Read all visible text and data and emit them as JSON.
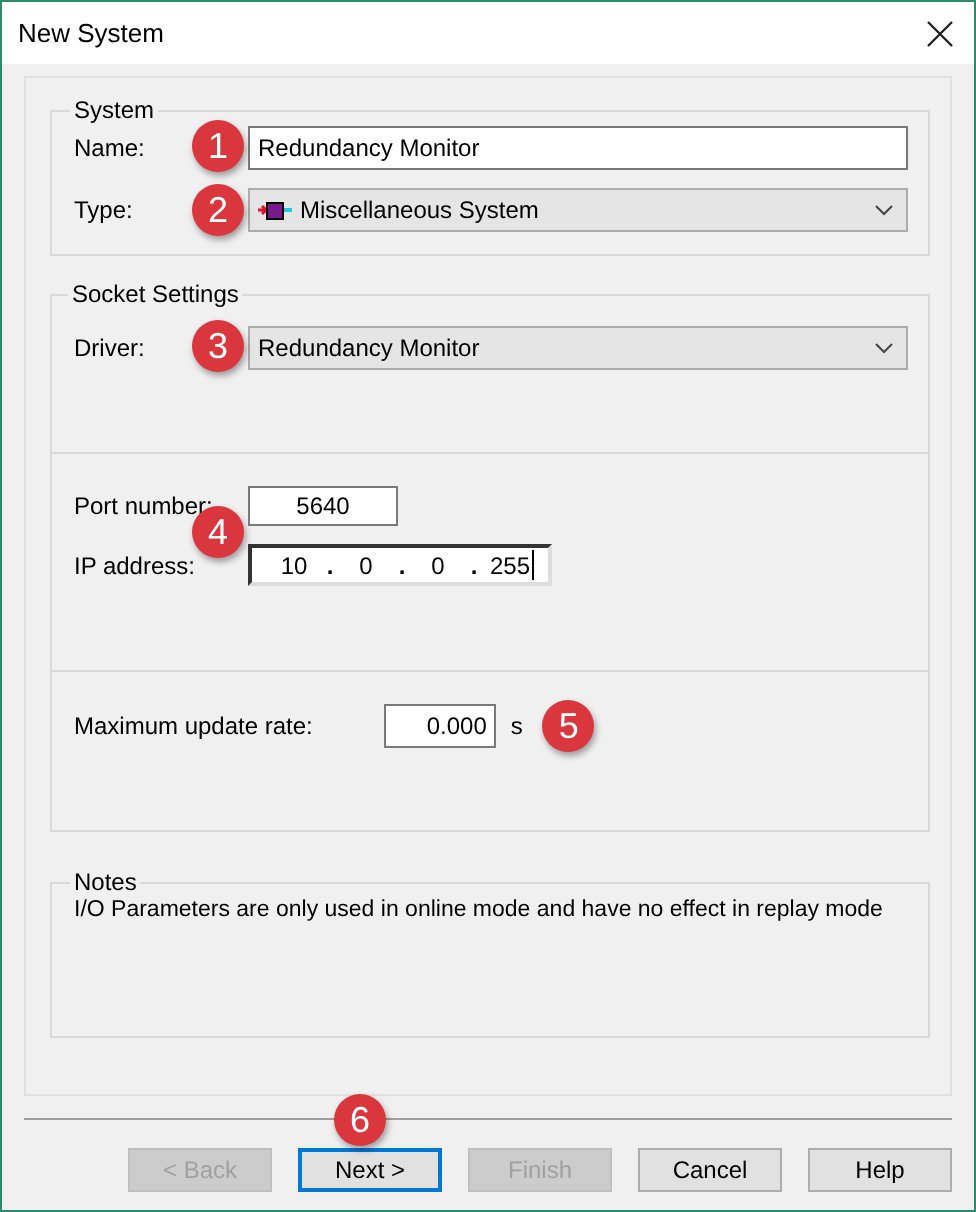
{
  "window": {
    "title": "New System"
  },
  "system": {
    "title": "System",
    "name": {
      "label": "Name:",
      "value": "Redundancy Monitor",
      "marker": "1"
    },
    "type": {
      "label": "Type:",
      "value": "Miscellaneous System",
      "marker": "2"
    }
  },
  "socket_settings": {
    "title": "Socket Settings",
    "driver": {
      "label": "Driver:",
      "value": "Redundancy Monitor",
      "marker": "3"
    },
    "connection": {
      "marker": "4",
      "port": {
        "label": "Port number:",
        "value": "5640"
      },
      "ip": {
        "label": "IP address:",
        "octets": [
          "10",
          "0",
          "0",
          "255"
        ],
        "separators": [
          ".",
          ".",
          "."
        ]
      }
    },
    "update_rate": {
      "label": "Maximum update rate:",
      "value": "0.000",
      "unit": "s",
      "marker": "5"
    }
  },
  "notes": {
    "title": "Notes",
    "text": "I/O Parameters are only used in online mode and have no effect in replay mode"
  },
  "footer": {
    "marker": "6"
  },
  "buttons": [
    {
      "label": "< Back",
      "disabled": true,
      "focused": false
    },
    {
      "label": "Next >",
      "disabled": false,
      "focused": true
    },
    {
      "label": "Finish",
      "disabled": true,
      "focused": false
    },
    {
      "label": "Cancel",
      "disabled": false,
      "focused": false
    },
    {
      "label": "Help",
      "disabled": false,
      "focused": false
    }
  ]
}
